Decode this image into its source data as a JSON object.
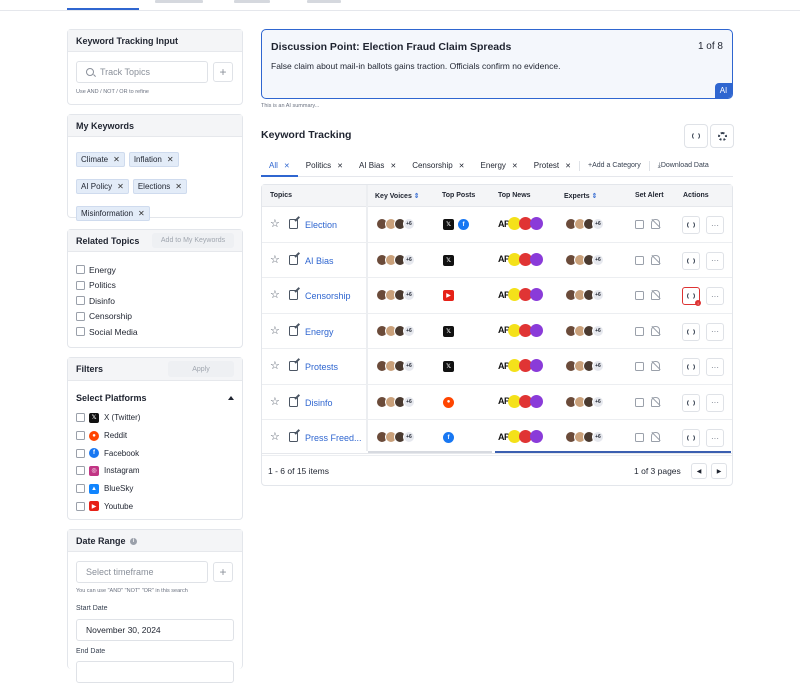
{
  "left": {
    "keyword_input": {
      "title": "Keyword Tracking Input",
      "placeholder": "Track Topics",
      "hint": "Use AND / NOT / OR to refine"
    },
    "my_keywords": {
      "title": "My Keywords",
      "chips": [
        "Climate",
        "Inflation",
        "AI Policy",
        "Elections",
        "Misinformation"
      ]
    },
    "related": {
      "title": "Related Topics",
      "button": "Add to My Keywords",
      "items": [
        "Energy",
        "Politics",
        "Disinfo",
        "Censorship",
        "Social Media"
      ]
    },
    "filters": {
      "title": "Filters",
      "apply": "Apply",
      "platforms_title": "Select Platforms",
      "platforms": [
        {
          "label": "X (Twitter)",
          "icon": "x-icon",
          "color": "#111111"
        },
        {
          "label": "Reddit",
          "icon": "reddit-icon",
          "color": "#ff4500"
        },
        {
          "label": "Facebook",
          "icon": "facebook-icon",
          "color": "#1877f2"
        },
        {
          "label": "Instagram",
          "icon": "instagram-icon",
          "color": "#c13584"
        },
        {
          "label": "BlueSky",
          "icon": "bluesky-icon",
          "color": "#1185fe"
        },
        {
          "label": "Youtube",
          "icon": "youtube-icon",
          "color": "#e62117"
        }
      ]
    },
    "date_range": {
      "title": "Date Range",
      "placeholder": "Select timeframe",
      "hint": "You can use \"AND\" \"NOT\" \"OR\" in this search",
      "start_label": "Start Date",
      "start_value": "November 30, 2024",
      "end_label": "End Date"
    }
  },
  "summary": {
    "title": "Discussion Point: Election Fraud Claim Spreads",
    "pager": "1 of 8",
    "body": "False claim about mail-in ballots gains traction. Officials confirm no evidence.",
    "ai_badge": "AI",
    "hint": "This is an AI summary..."
  },
  "tracking": {
    "title": "Keyword Tracking",
    "tabs": [
      "All",
      "Politics",
      "AI Bias",
      "Censorship",
      "Energy",
      "Protest"
    ],
    "add_category": "Add a Category",
    "download": "Download Data",
    "columns": [
      "Topics",
      "Key Voices",
      "Top Posts",
      "Top News",
      "Experts",
      "Set Alert",
      "Actions"
    ],
    "more_count": "+6",
    "news_ap": "AP",
    "rows": [
      {
        "topic": "Election",
        "posts": [
          "x",
          "facebook"
        ],
        "alert_flag": false
      },
      {
        "topic": "AI Bias",
        "posts": [
          "x"
        ],
        "alert_flag": false
      },
      {
        "topic": "Censorship",
        "posts": [
          "youtube"
        ],
        "alert_flag": true
      },
      {
        "topic": "Energy",
        "posts": [
          "x"
        ],
        "alert_flag": false
      },
      {
        "topic": "Protests",
        "posts": [
          "x"
        ],
        "alert_flag": false
      },
      {
        "topic": "Disinfo",
        "posts": [
          "reddit"
        ],
        "alert_flag": false
      },
      {
        "topic": "Press Freed...",
        "posts": [
          "facebook"
        ],
        "alert_flag": false
      }
    ],
    "footer_items": "1 - 6 of 15 items",
    "footer_pages": "1 of 3 pages"
  },
  "colors": {
    "accent": "#2f66d0",
    "alert": "#dd3333"
  }
}
